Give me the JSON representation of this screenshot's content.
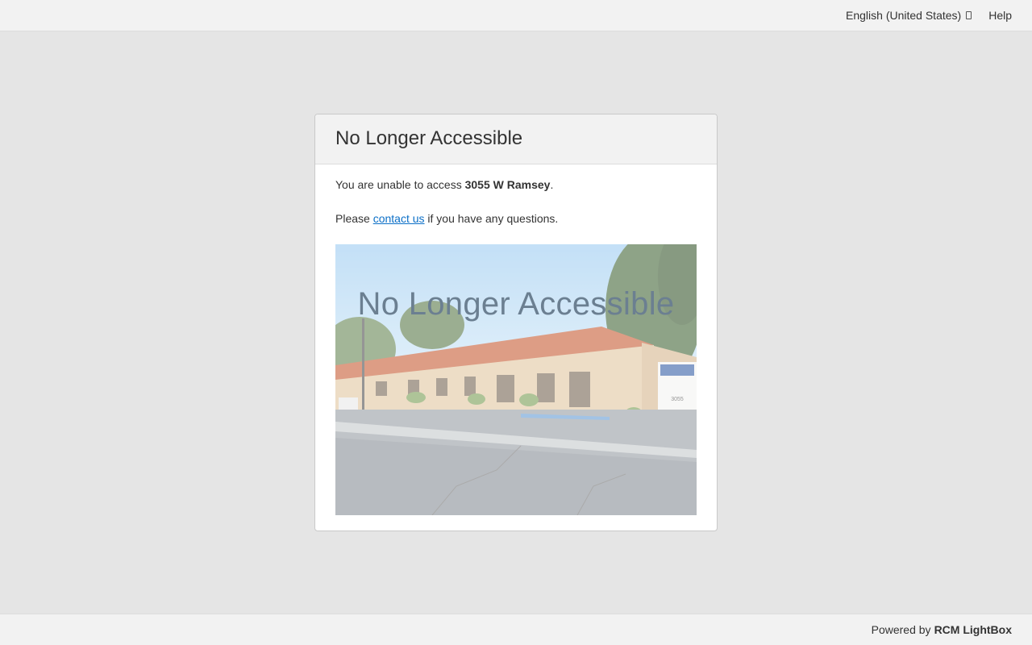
{
  "topbar": {
    "language_label": "English (United States)",
    "language_icon": "external-link-icon",
    "help_label": "Help"
  },
  "card": {
    "title": "No Longer Accessible",
    "message_prefix": "You are unable to access ",
    "property_name": "3055 W Ramsey",
    "message_suffix": ".",
    "contact_prefix": "Please ",
    "contact_link": "contact us",
    "contact_suffix": " if you have any questions.",
    "photo_overlay_text": "No Longer Accessible",
    "photo_sign_text": "3055"
  },
  "footer": {
    "powered_prefix": "Powered by",
    "brand": "RCM LightBox"
  },
  "colors": {
    "background": "#e5e5e5",
    "bar": "#f2f2f2",
    "link": "#0b6fc7"
  }
}
